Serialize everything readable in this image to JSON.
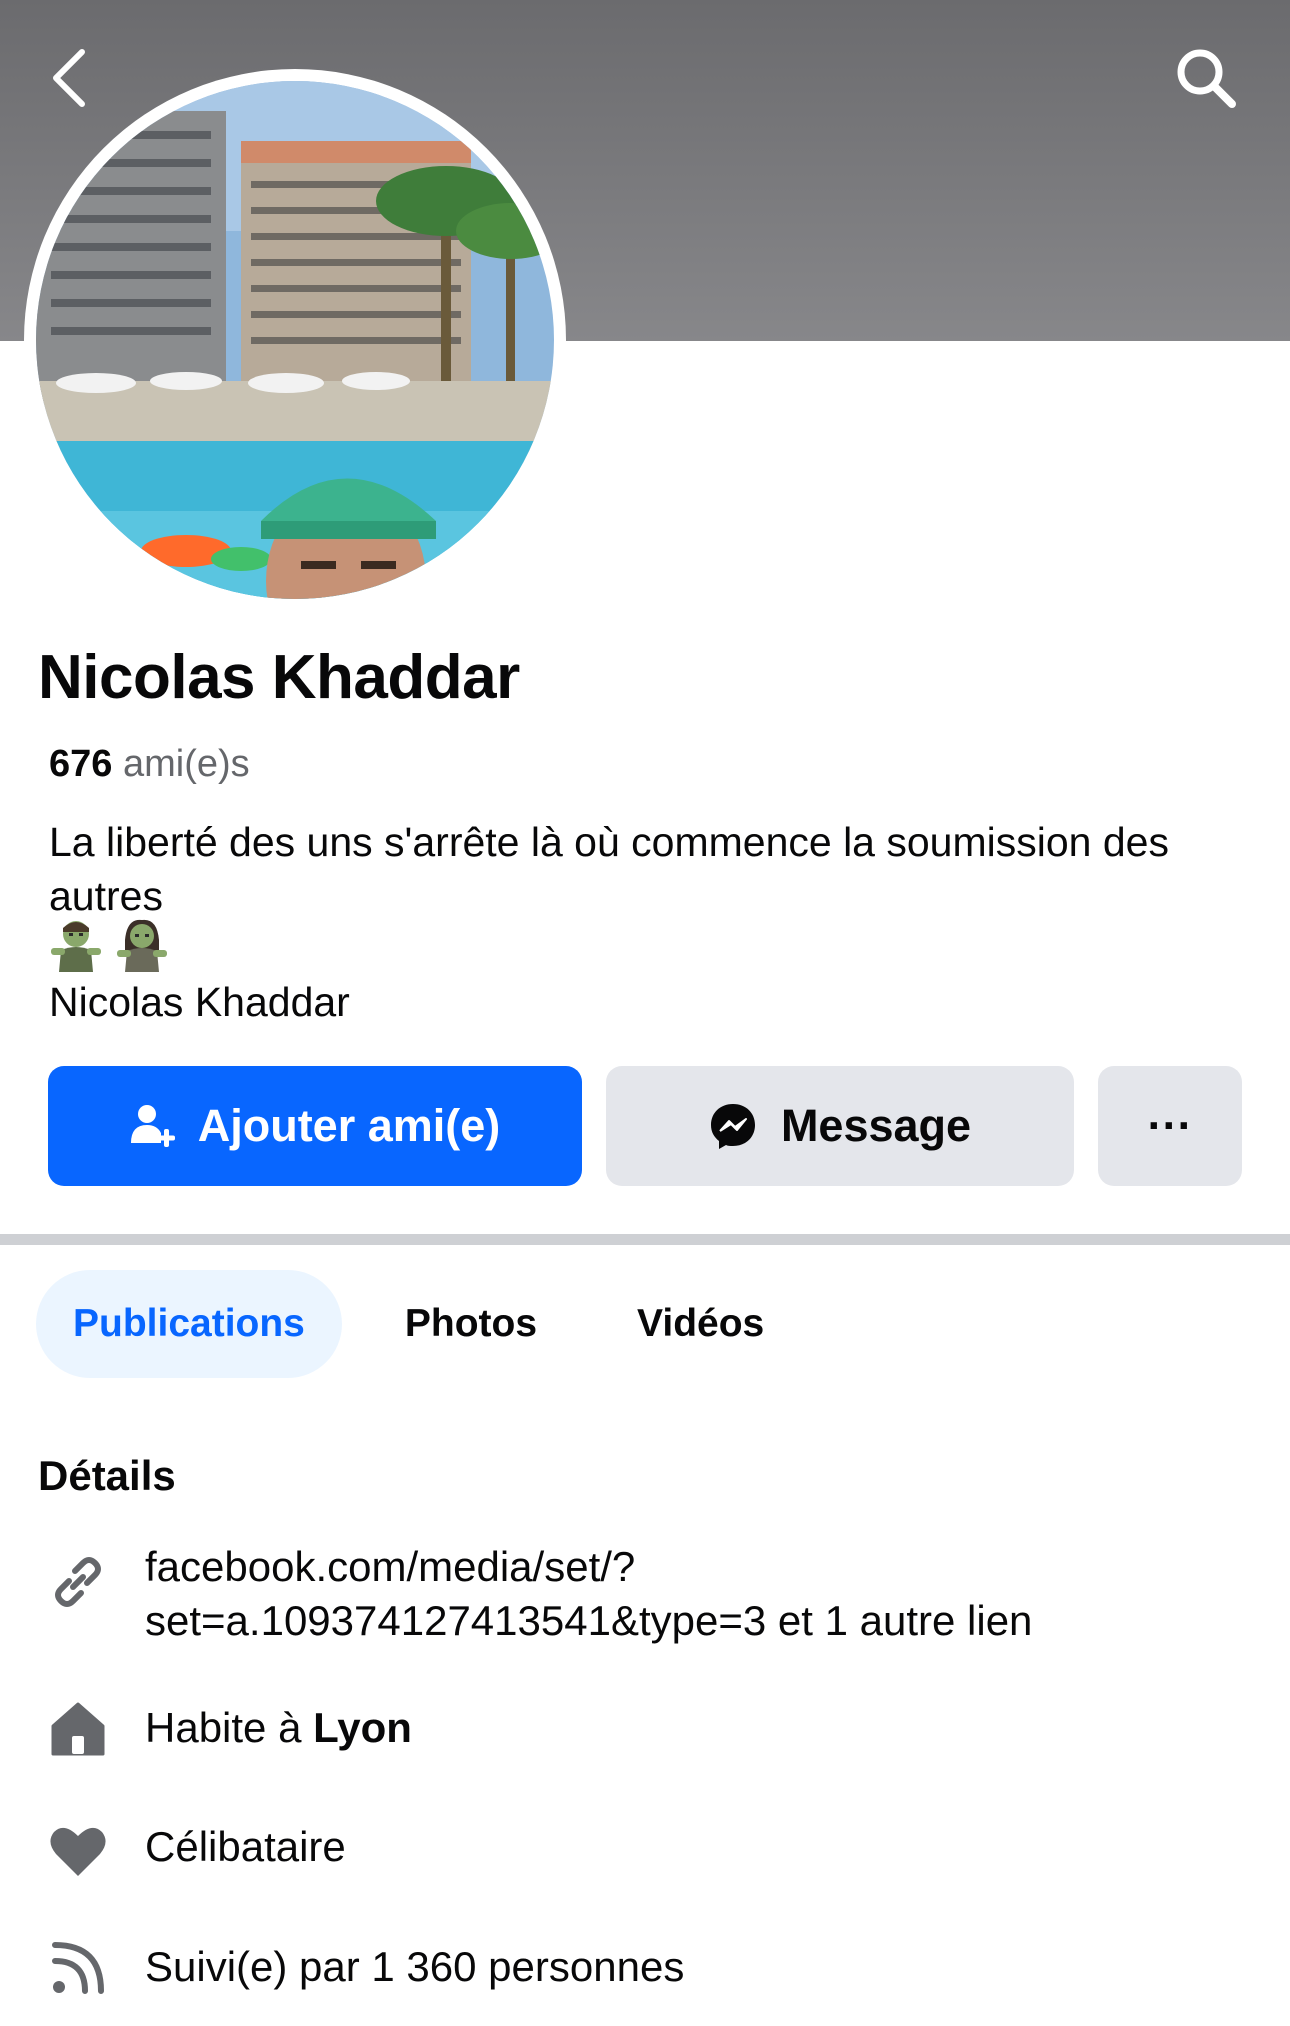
{
  "colors": {
    "accent": "#0866ff",
    "cover_gray": "#7a7a7d",
    "button_gray": "#e4e6eb",
    "active_tab_bg": "#ebf5ff",
    "divider": "#ced0d4",
    "icon_gray": "#65676b"
  },
  "header": {
    "back_icon": "chevron-left-icon",
    "search_icon": "search-icon"
  },
  "profile": {
    "name": "Nicolas Khaddar",
    "friends_count": "676",
    "friends_label": "ami(e)s",
    "bio": "La liberté des uns s'arrête là où commence la soumission des autres",
    "bio_emojis": [
      "zombie-man-emoji",
      "zombie-woman-emoji"
    ],
    "bio_name": "Nicolas Khaddar"
  },
  "actions": {
    "add_friend_label": "Ajouter ami(e)",
    "message_label": "Message",
    "more_label": "···"
  },
  "tabs": [
    {
      "label": "Publications",
      "active": true
    },
    {
      "label": "Photos",
      "active": false
    },
    {
      "label": "Vidéos",
      "active": false
    }
  ],
  "details": {
    "title": "Détails",
    "link_line1": "facebook.com/media/set/?",
    "link_line2": "set=a.109374127413541&type=3 et 1 autre lien",
    "lives_prefix": "Habite à",
    "lives_city": "Lyon",
    "relationship": "Célibataire",
    "followers": "Suivi(e) par 1 360 personnes"
  }
}
